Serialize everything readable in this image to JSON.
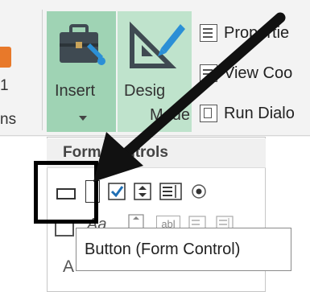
{
  "left_fragments": {
    "top": "1",
    "bottom": "ns"
  },
  "ribbon": {
    "insert_label": "Insert",
    "design_label_line1": "Desig",
    "design_label_line2": "Mode",
    "right_items": [
      "Propertie",
      "View Coo",
      "Run Dialo"
    ]
  },
  "dropdown": {
    "title": "Form Controls",
    "controls_row1": [
      "button-form-control-icon",
      "combo-box-icon",
      "check-box-icon",
      "spin-button-icon",
      "list-box-icon",
      "option-button-icon"
    ],
    "controls_row2": [
      "group-box-icon",
      "label-icon",
      "scroll-bar-icon",
      "text-field-icon",
      "combo-list-edit-icon",
      "combo-dropdown-edit-icon"
    ],
    "row2_aa_text": "Aa",
    "row2_abl_text": "abl",
    "section_a": "A"
  },
  "tooltip": {
    "text": "Button (Form Control)"
  },
  "colors": {
    "insert_bg": "#9fd3b4",
    "design_bg": "#bfe3cc",
    "highlight": "#000000",
    "arrow": "#111111"
  }
}
